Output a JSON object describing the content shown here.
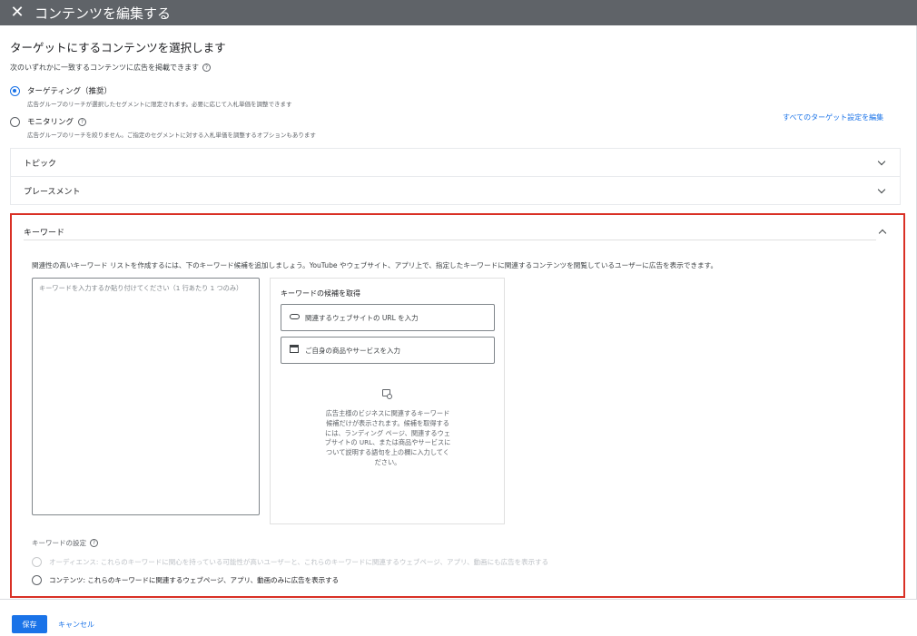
{
  "header": {
    "title": "コンテンツを編集する",
    "close_icon": "close-icon"
  },
  "section": {
    "heading": "ターゲットにするコンテンツを選択します",
    "subtext": "次のいずれかに一致するコンテンツに広告を掲載できます"
  },
  "targeting_mode": {
    "options": [
      {
        "label": "ターゲティング（推奨）",
        "desc": "広告グループのリーチが選択したセグメントに限定されます。必要に応じて入札単価を調整できます",
        "selected": true
      },
      {
        "label": "モニタリング",
        "desc": "広告グループのリーチを絞りません。ご指定のセグメントに対する入札単価を調整するオプションもあります",
        "selected": false
      }
    ],
    "edit_all_link": "すべてのターゲット設定を編集"
  },
  "panels": [
    {
      "title": "トピック"
    },
    {
      "title": "プレースメント"
    }
  ],
  "keywords": {
    "title": "キーワード",
    "description": "関連性の高いキーワード リストを作成するには、下のキーワード候補を追加しましょう。YouTube やウェブサイト、アプリ上で、指定したキーワードに関連するコンテンツを閲覧しているユーザーに広告を表示できます。",
    "input_placeholder": "キーワードを入力するか貼り付けてください（1 行あたり 1 つのみ）",
    "suggestions": {
      "title": "キーワードの候補を取得",
      "url_button": "関連するウェブサイトの URL を入力",
      "product_button": "ご自身の商品やサービスを入力",
      "info": "広告主様のビジネスに関連するキーワード候補だけが表示されます。候補を取得するには、ランディング ページ、関連するウェブサイトの URL、または商品やサービスについて説明する語句を上の欄に入力してください。"
    },
    "setting_label": "キーワードの設定",
    "setting_options": [
      {
        "label": "オーディエンス: これらのキーワードに関心を持っている可能性が高いユーザーと、これらのキーワードに関連するウェブページ、アプリ、動画にも広告を表示する",
        "disabled": true
      },
      {
        "label": "コンテンツ: これらのキーワードに関連するウェブページ、アプリ、動画のみに広告を表示する",
        "disabled": false
      }
    ]
  },
  "footer": {
    "save_label": "保存",
    "cancel_label": "キャンセル"
  },
  "colors": {
    "accent": "#1a73e8",
    "highlight_border": "#d93025",
    "topbar": "#5f6368"
  }
}
